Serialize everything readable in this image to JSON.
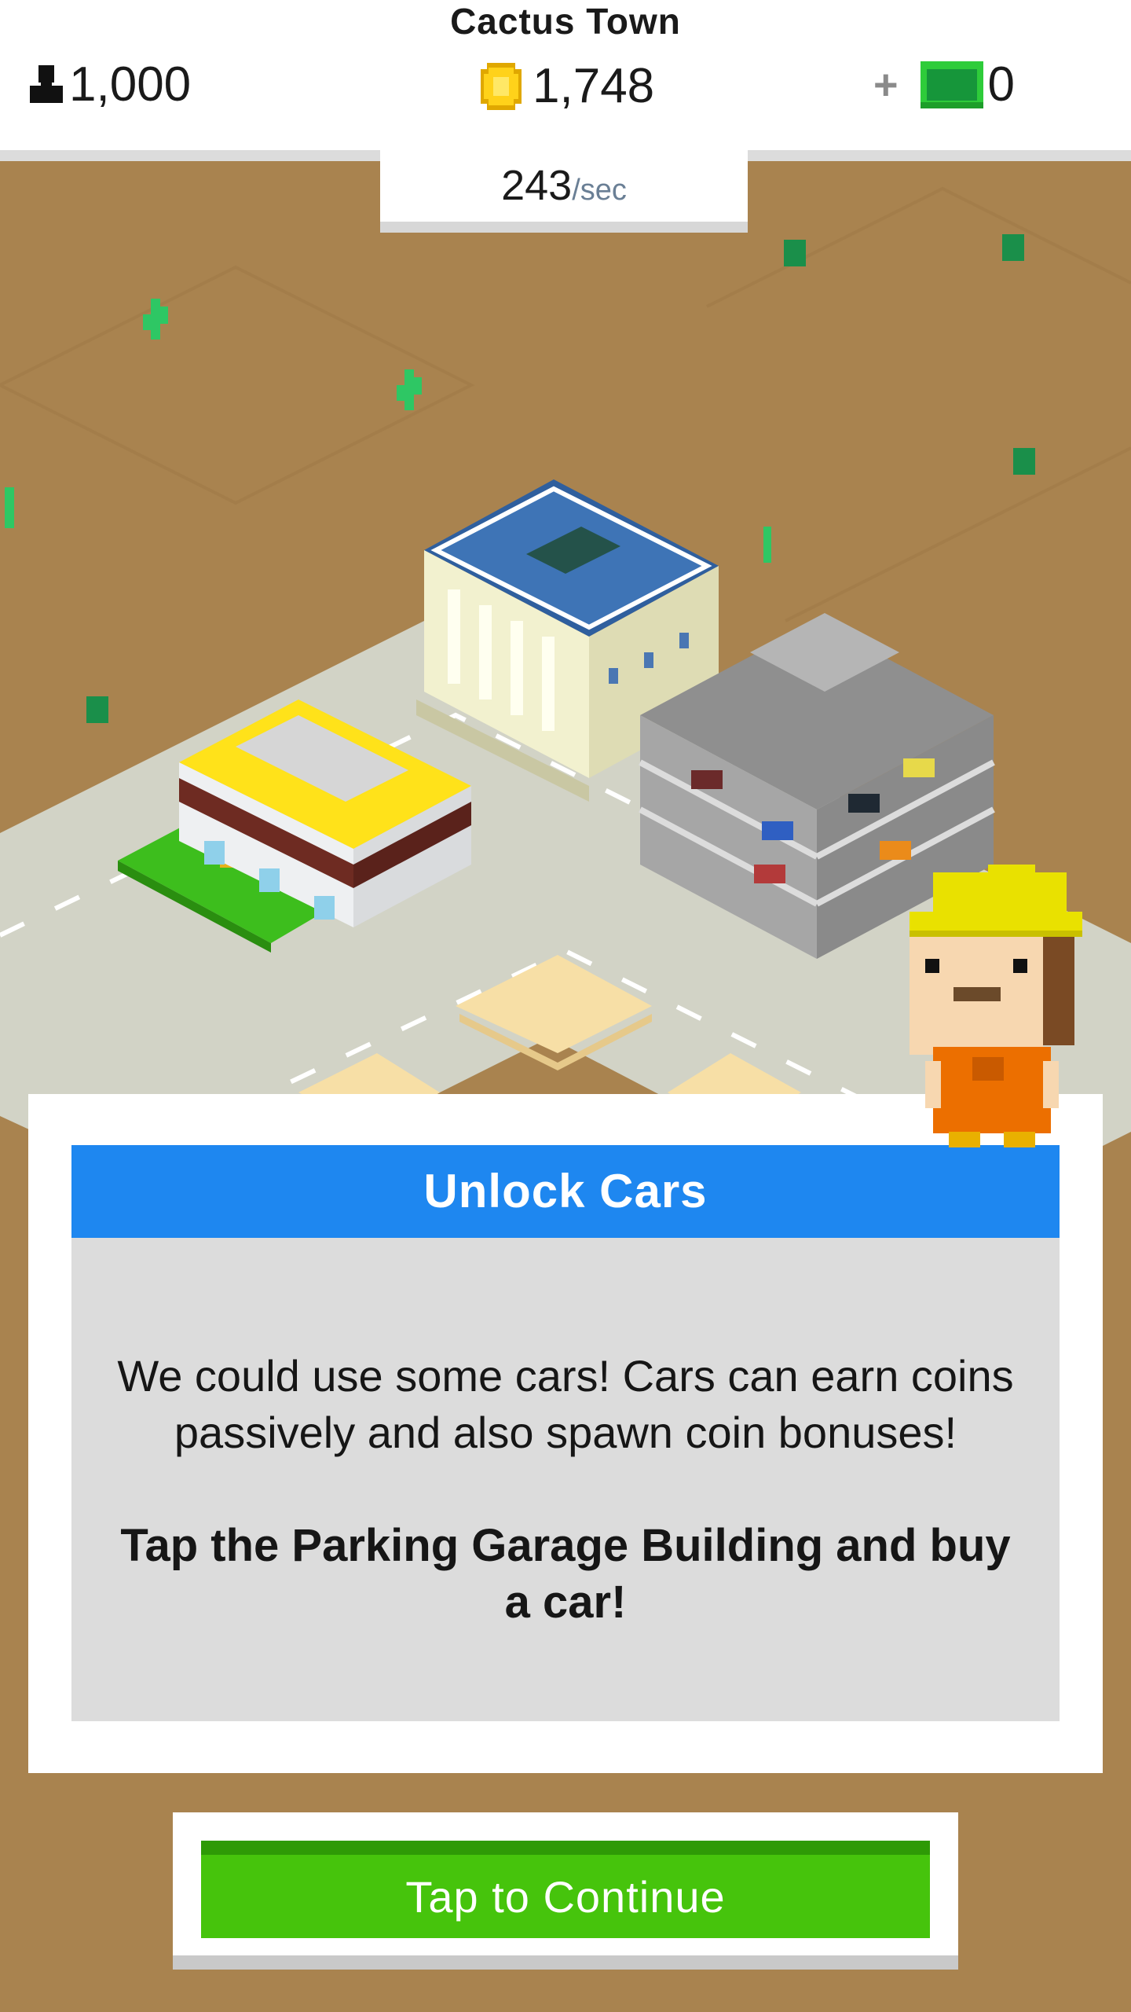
{
  "header": {
    "town_name": "Cactus Town",
    "population": "1,000",
    "coins": "1,748",
    "cash": "0",
    "income_rate": "243",
    "income_unit": "/sec"
  },
  "dialog": {
    "title": "Unlock Cars",
    "body": "We could use some cars! Cars can earn coins passively and also spawn coin bonuses!",
    "instruction": "Tap the Parking Garage Building and buy a car!"
  },
  "continue_button": {
    "label": "Tap to Continue"
  },
  "icons": {
    "population": "person-icon",
    "coins": "coin-icon",
    "cash_add": "plus-icon",
    "cash": "cash-icon"
  },
  "colors": {
    "desert": "#a9834f",
    "header_blue": "#1e87f0",
    "button_green": "#46c40c",
    "body_gray": "#dcdcdc"
  }
}
